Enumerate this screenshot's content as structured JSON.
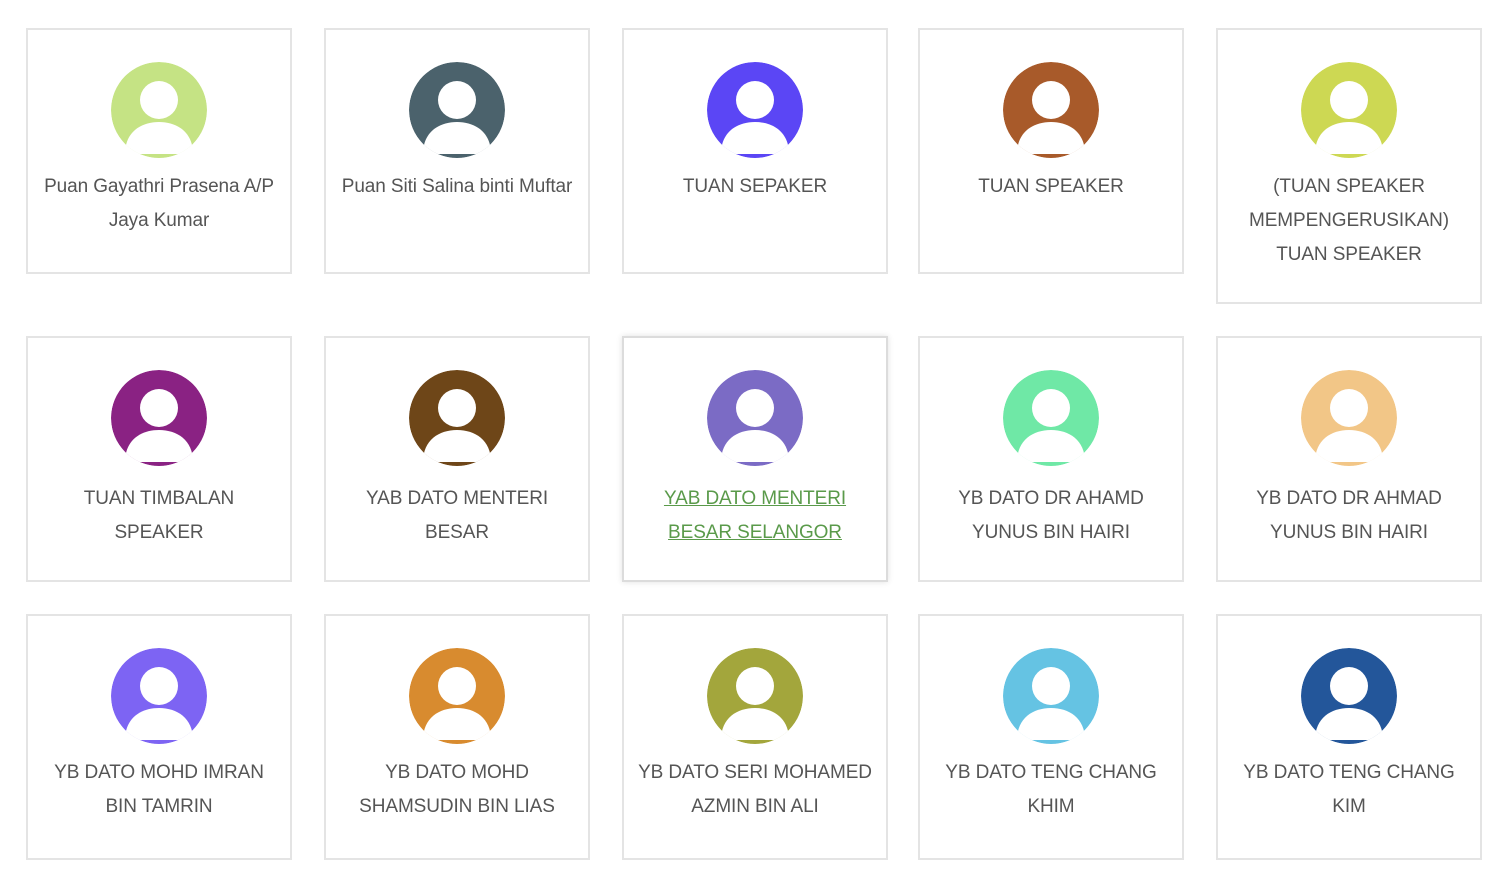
{
  "members": [
    {
      "name": "Puan Gayathri Prasena A/P Jaya Kumar",
      "avatar_color": "#c5e384"
    },
    {
      "name": "Puan Siti Salina binti Muftar",
      "avatar_color": "#4b626c"
    },
    {
      "name": "TUAN SEPAKER",
      "avatar_color": "#5b46f5"
    },
    {
      "name": "TUAN SPEAKER",
      "avatar_color": "#a85a2a"
    },
    {
      "name": "(TUAN SPEAKER MEMPENGERUSIKAN) TUAN SPEAKER",
      "avatar_color": "#cdd853"
    },
    {
      "name": "TUAN TIMBALAN SPEAKER",
      "avatar_color": "#8a2283"
    },
    {
      "name": "YAB DATO MENTERI BESAR",
      "avatar_color": "#6e4618"
    },
    {
      "name": "YAB DATO MENTERI BESAR SELANGOR",
      "avatar_color": "#7b6bc5",
      "active": true
    },
    {
      "name": "YB DATO DR AHAMD YUNUS BIN HAIRI",
      "avatar_color": "#6fe8a6"
    },
    {
      "name": "YB DATO DR AHMAD YUNUS BIN HAIRI",
      "avatar_color": "#f2c687"
    },
    {
      "name": "YB DATO MOHD IMRAN BIN TAMRIN",
      "avatar_color": "#7d64f3"
    },
    {
      "name": "YB DATO MOHD SHAMSUDIN BIN LIAS",
      "avatar_color": "#d88b2f"
    },
    {
      "name": "YB DATO SERI MOHAMED AZMIN BIN ALI",
      "avatar_color": "#a3a63c"
    },
    {
      "name": "YB DATO TENG CHANG KHIM",
      "avatar_color": "#65c3e3"
    },
    {
      "name": "YB DATO TENG CHANG KIM",
      "avatar_color": "#23569a"
    }
  ],
  "colors": {
    "border": "#e4e4e4",
    "text": "#555555",
    "active_link": "#5a9a4a"
  },
  "icons": {
    "avatar": "user-silhouette-icon"
  }
}
